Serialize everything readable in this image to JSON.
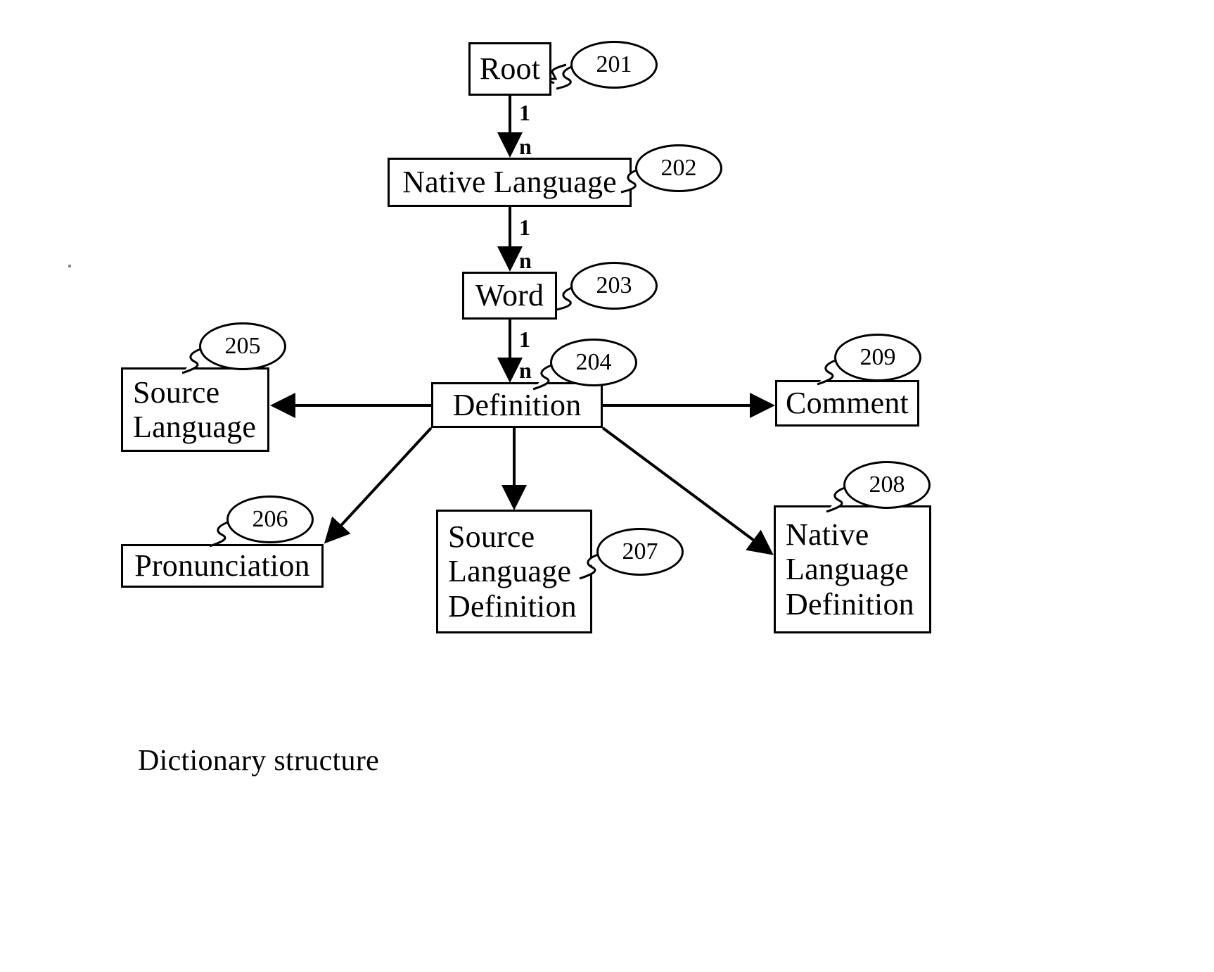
{
  "figure": {
    "caption": "Dictionary structure",
    "background_color": "#ffffff",
    "stroke_color": "#000000"
  },
  "nodes": {
    "root": {
      "label": "Root",
      "ref": "201"
    },
    "native_language": {
      "label": "Native Language",
      "ref": "202"
    },
    "word": {
      "label": "Word",
      "ref": "203"
    },
    "definition": {
      "label": "Definition",
      "ref": "204"
    },
    "source_language": {
      "line1": "Source",
      "line2": "Language",
      "ref": "205"
    },
    "pronunciation": {
      "label": "Pronunciation",
      "ref": "206"
    },
    "source_language_definition": {
      "line1": "Source",
      "line2": "Language",
      "line3": "Definition",
      "ref": "207"
    },
    "native_language_definition": {
      "line1": "Native",
      "line2": "Language",
      "line3": "Definition",
      "ref": "208"
    },
    "comment": {
      "label": "Comment",
      "ref": "209"
    }
  },
  "edge_labels": {
    "root_to_native_one": "1",
    "root_to_native_many": "n",
    "native_to_word_one": "1",
    "native_to_word_many": "n",
    "word_to_definition_one": "1",
    "word_to_definition_many": "n"
  },
  "chart_data": {
    "type": "diagram",
    "title": "Dictionary structure",
    "subtype": "entity-relationship tree",
    "entities": [
      {
        "id": "201",
        "name": "Root"
      },
      {
        "id": "202",
        "name": "Native Language"
      },
      {
        "id": "203",
        "name": "Word"
      },
      {
        "id": "204",
        "name": "Definition"
      },
      {
        "id": "205",
        "name": "Source Language"
      },
      {
        "id": "206",
        "name": "Pronunciation"
      },
      {
        "id": "207",
        "name": "Source Language Definition"
      },
      {
        "id": "208",
        "name": "Native Language Definition"
      },
      {
        "id": "209",
        "name": "Comment"
      }
    ],
    "relationships": [
      {
        "from": "Root",
        "to": "Native Language",
        "from_card": "1",
        "to_card": "n",
        "arrow": "down"
      },
      {
        "from": "Native Language",
        "to": "Word",
        "from_card": "1",
        "to_card": "n",
        "arrow": "down"
      },
      {
        "from": "Word",
        "to": "Definition",
        "from_card": "1",
        "to_card": "n",
        "arrow": "down"
      },
      {
        "from": "Definition",
        "to": "Source Language",
        "from_card": "",
        "to_card": "",
        "arrow": "left"
      },
      {
        "from": "Definition",
        "to": "Comment",
        "from_card": "",
        "to_card": "",
        "arrow": "right"
      },
      {
        "from": "Definition",
        "to": "Pronunciation",
        "from_card": "",
        "to_card": "",
        "arrow": "down-left"
      },
      {
        "from": "Definition",
        "to": "Source Language Definition",
        "from_card": "",
        "to_card": "",
        "arrow": "down"
      },
      {
        "from": "Definition",
        "to": "Native Language Definition",
        "from_card": "",
        "to_card": "",
        "arrow": "down-right"
      }
    ]
  }
}
